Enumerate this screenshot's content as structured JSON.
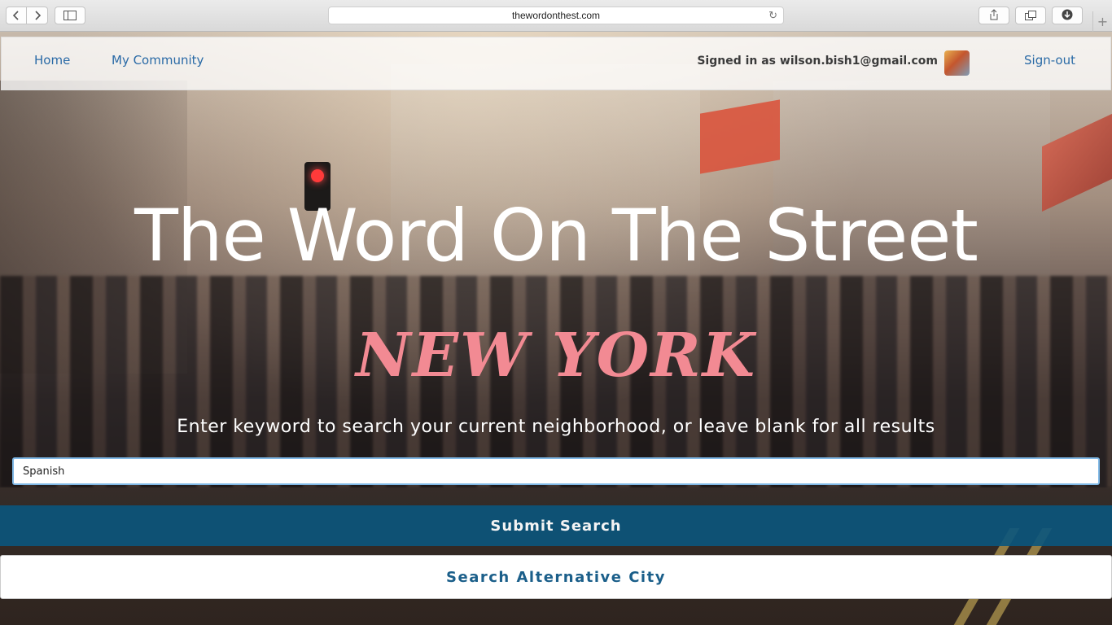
{
  "browser": {
    "url": "thewordonthest.com",
    "back_icon": "chevron-left-icon",
    "forward_icon": "chevron-right-icon",
    "reload_icon": "reload-icon"
  },
  "nav": {
    "home_label": "Home",
    "community_label": "My Community",
    "signed_in_text": "Signed in as wilson.bish1@gmail.com",
    "signout_label": "Sign-out",
    "link_color": "#2a6aa6"
  },
  "hero": {
    "title": "The Word On The Street",
    "city": "NEW YORK",
    "city_color": "#f28a93",
    "instructions": "Enter keyword to search your current neighborhood, or leave blank for all results"
  },
  "search": {
    "value": "Spanish",
    "placeholder": ""
  },
  "buttons": {
    "submit_label": "Submit Search",
    "submit_color": "#0a557d",
    "alt_city_label": "Search Alternative City",
    "alt_city_color": "#1b5f8a"
  }
}
